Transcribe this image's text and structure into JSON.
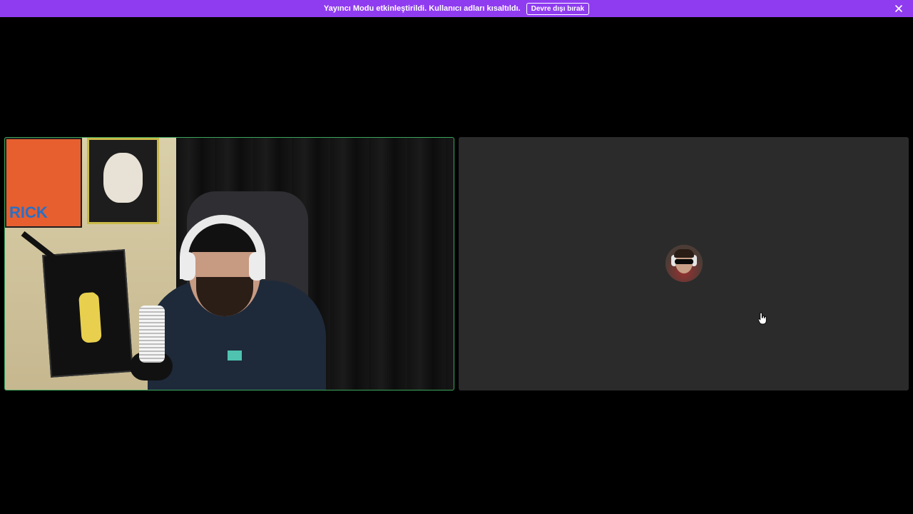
{
  "notice_bar": {
    "message": "Yayıncı Modu etkinleştirildi. Kullanıcı adları kısaltıldı.",
    "disable_button_label": "Devre dışı bırak",
    "close_icon": "close-icon",
    "background_color": "#8f3cf0"
  },
  "video_grid": {
    "tiles": [
      {
        "type": "camera-video",
        "speaking_indicator_color": "#3ba55d",
        "scene_text": "RICK"
      },
      {
        "type": "avatar-only",
        "avatar_icon": "user-avatar"
      }
    ]
  },
  "cursor": {
    "icon": "hand-pointer-cursor"
  }
}
